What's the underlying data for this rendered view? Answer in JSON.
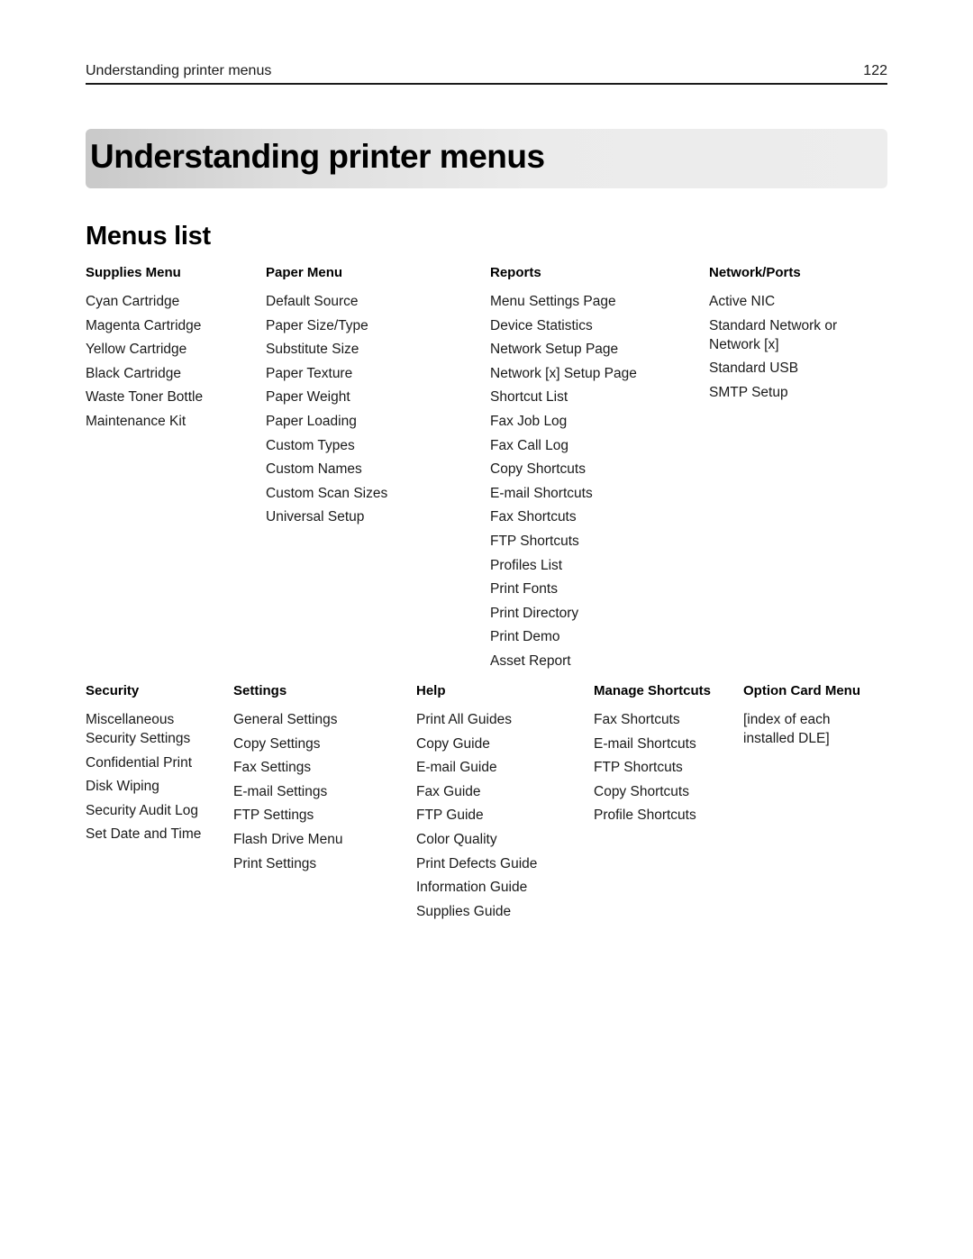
{
  "header": {
    "running_title": "Understanding printer menus",
    "page_number": "122"
  },
  "chapter_title": "Understanding printer menus",
  "section_title": "Menus list",
  "menus": [
    {
      "heading": "Supplies Menu",
      "items": [
        "Cyan Cartridge",
        "Magenta Cartridge",
        "Yellow Cartridge",
        "Black Cartridge",
        "Waste Toner Bottle",
        "Maintenance Kit"
      ]
    },
    {
      "heading": "Paper Menu",
      "items": [
        "Default Source",
        "Paper Size/Type",
        "Substitute Size",
        "Paper Texture",
        "Paper Weight",
        "Paper Loading",
        "Custom Types",
        "Custom Names",
        "Custom Scan Sizes",
        "Universal Setup"
      ]
    },
    {
      "heading": "Reports",
      "items": [
        "Menu Settings Page",
        "Device Statistics",
        "Network Setup Page",
        "Network [x] Setup Page",
        "Shortcut List",
        "Fax Job Log",
        "Fax Call Log",
        "Copy Shortcuts",
        "E-mail Shortcuts",
        "Fax Shortcuts",
        "FTP Shortcuts",
        "Profiles List",
        "Print Fonts",
        "Print Directory",
        "Print Demo",
        "Asset Report"
      ]
    },
    {
      "heading": "Network/Ports",
      "items": [
        "Active NIC",
        "Standard Network or Network [x]",
        "Standard USB",
        "SMTP Setup"
      ]
    },
    {
      "heading": "Security",
      "items": [
        "Miscellaneous Security Settings",
        "Confidential Print",
        "Disk Wiping",
        "Security Audit Log",
        "Set Date and Time"
      ]
    },
    {
      "heading": "Settings",
      "items": [
        "General Settings",
        "Copy Settings",
        "Fax Settings",
        "E-mail Settings",
        "FTP Settings",
        "Flash Drive Menu",
        "Print Settings"
      ]
    },
    {
      "heading": "Help",
      "items": [
        "Print All Guides",
        "Copy Guide",
        "E-mail Guide",
        "Fax Guide",
        "FTP Guide",
        "Color Quality",
        "Print Defects Guide",
        "Information Guide",
        "Supplies Guide"
      ]
    },
    {
      "heading": "Manage Shortcuts",
      "items": [
        "Fax Shortcuts",
        "E-mail Shortcuts",
        "FTP Shortcuts",
        "Copy Shortcuts",
        "Profile Shortcuts"
      ]
    },
    {
      "heading": "Option Card Menu",
      "items": [
        "[index of each installed DLE]"
      ]
    }
  ]
}
